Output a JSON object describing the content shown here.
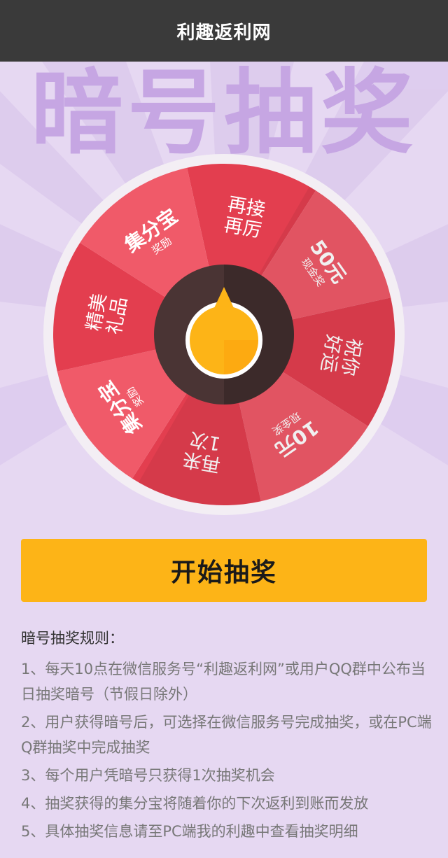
{
  "header": {
    "title": "利趣返利网"
  },
  "banner": {
    "text": "暗号抽奖"
  },
  "wheel": {
    "segments": [
      {
        "big": "再接再厉",
        "small": ""
      },
      {
        "big": "50元",
        "small": "现金奖"
      },
      {
        "big": "祝你好运",
        "small": ""
      },
      {
        "big": "10元",
        "small": "现金奖"
      },
      {
        "big": "再来1次",
        "small": ""
      },
      {
        "big": "集分宝",
        "small": "奖励"
      },
      {
        "big": "精美礼品",
        "small": ""
      },
      {
        "big": "集分宝",
        "small": "奖励"
      }
    ],
    "colors": {
      "dark": "#e33e4f",
      "light": "#f05a69",
      "rim": "#f3eef4",
      "hub": "#4a3434",
      "pointer": "#fdb417"
    }
  },
  "start_button": {
    "label": "开始抽奖"
  },
  "rules": {
    "title": "暗号抽奖规则：",
    "items": [
      "1、每天10点在微信服务号“利趣返利网”或用户QQ群中公布当日抽奖暗号（节假日除外）",
      "2、用户获得暗号后，可选择在微信服务号完成抽奖，或在PC端Q群抽奖中完成抽奖",
      "3、每个用户凭暗号只获得1次抽奖机会",
      "4、抽奖获得的集分宝将随着你的下次返利到账而发放",
      "5、具体抽奖信息请至PC端我的利趣中查看抽奖明细"
    ]
  }
}
